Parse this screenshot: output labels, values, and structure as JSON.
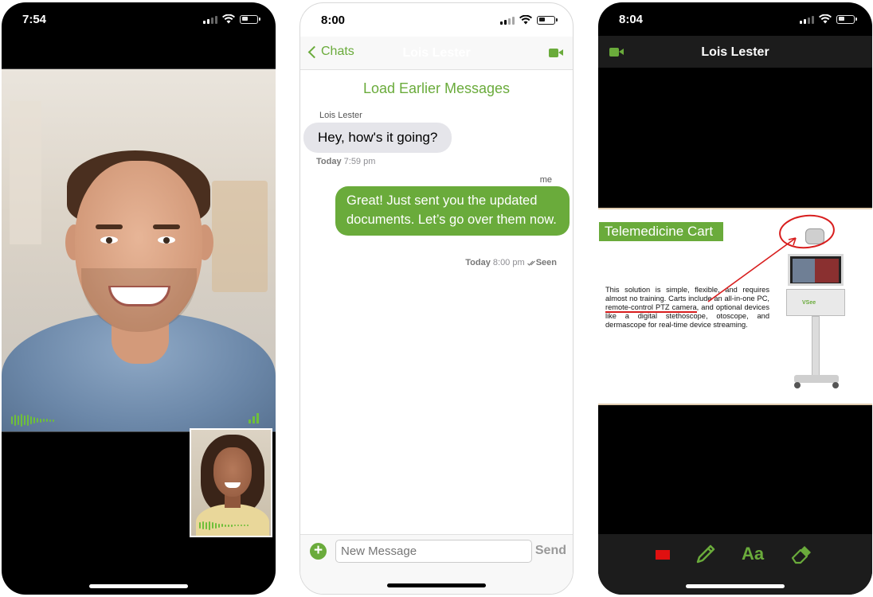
{
  "screens": [
    {
      "status_time": "7:54",
      "type": "video-call"
    },
    {
      "status_time": "8:00",
      "type": "chat",
      "nav": {
        "back_label": "Chats",
        "title": "Lois Lester"
      },
      "load_earlier": "Load Earlier Messages",
      "messages": [
        {
          "sender": "Lois Lester",
          "text": "Hey, how's it going?",
          "day": "Today",
          "time": "7:59 pm"
        },
        {
          "sender": "me",
          "text": "Great! Just sent you the updated documents. Let’s go over them now.",
          "day": "Today",
          "time": "8:00 pm",
          "status": "Seen"
        }
      ],
      "compose": {
        "placeholder": "New Message",
        "send_label": "Send"
      }
    },
    {
      "status_time": "8:04",
      "type": "screen-share-annotation",
      "nav": {
        "title": "Lois Lester"
      },
      "slide": {
        "title": "Telemedicine Cart",
        "body_part1": "This solution is simple, flexible, and requires almost no training. Carts include an all-in-one PC, ",
        "body_highlight": "remote-control PTZ camera",
        "body_part2": ", and optional devices like a digital stethoscope, otoscope, and dermascope for real-time device streaming.",
        "brand": "VSee"
      },
      "toolbar": {
        "text_tool_label": "Aa",
        "pen_color": "#e01010"
      }
    }
  ],
  "colors": {
    "accent": "#6aab3b",
    "annotation": "#d81e1e"
  }
}
